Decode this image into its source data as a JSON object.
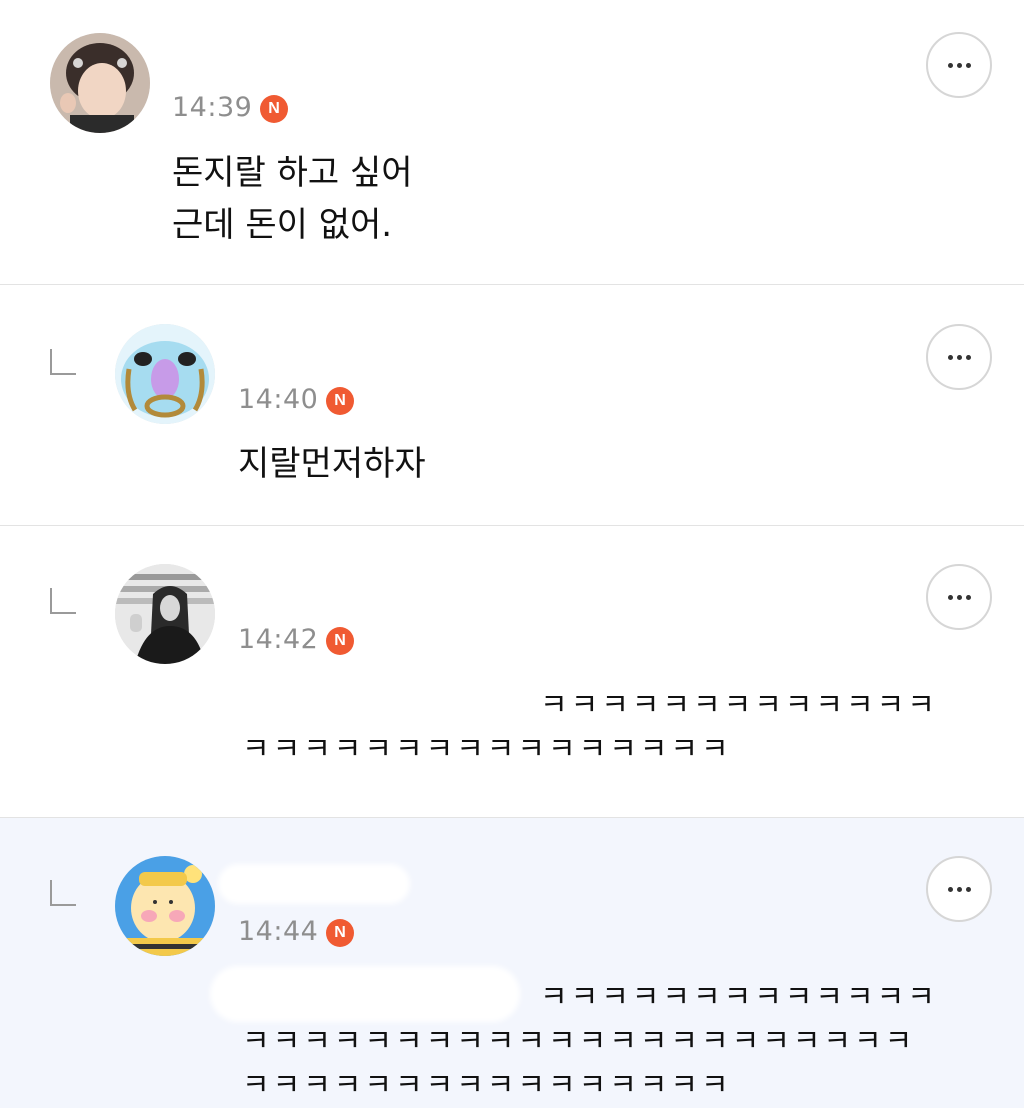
{
  "comments": [
    {
      "avatar": "user-photo-avatar",
      "time": "14:39",
      "badge": "N",
      "lines": [
        "돈지랄 하고 싶어",
        "근데 돈이 없어."
      ]
    },
    {
      "avatar": "cartoon-avatar",
      "time": "14:40",
      "badge": "N",
      "lines": [
        "지랄먼저하자"
      ]
    },
    {
      "avatar": "selfie-bw-avatar",
      "time": "14:42",
      "badge": "N",
      "lines": [
        "ㅋㅋㅋㅋㅋㅋㅋㅋㅋㅋㅋㅋㅋ",
        "ㅋㅋㅋㅋㅋㅋㅋㅋㅋㅋㅋㅋㅋㅋㅋㅋ"
      ]
    },
    {
      "avatar": "bee-character-avatar",
      "time": "14:44",
      "badge": "N",
      "lines": [
        "ㅋㅋㅋㅋㅋㅋㅋㅋㅋㅋㅋㅋㅋ",
        "ㅋㅋㅋㅋㅋㅋㅋㅋㅋㅋㅋㅋㅋㅋㅋㅋㅋㅋㅋㅋㅋㅋ",
        "ㅋㅋㅋㅋㅋㅋㅋㅋㅋㅋㅋㅋㅋㅋㅋㅋ"
      ]
    }
  ],
  "icons": {
    "more": "more-horizontal-icon",
    "reply": "reply-arrow-icon"
  },
  "colors": {
    "badge": "#f05a32",
    "highlight": "#f3f6fd"
  }
}
